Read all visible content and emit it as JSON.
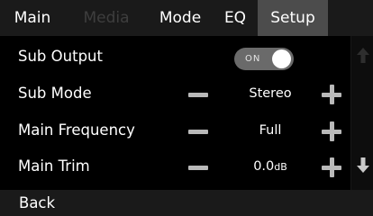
{
  "tabs": [
    {
      "label": "Main",
      "state": "normal"
    },
    {
      "label": "Media",
      "state": "disabled"
    },
    {
      "label": "Mode",
      "state": "normal"
    },
    {
      "label": "EQ",
      "state": "normal"
    },
    {
      "label": "Setup",
      "state": "active"
    }
  ],
  "rows": [
    {
      "label": "Sub Output",
      "toggle": "ON"
    },
    {
      "label": "Sub Mode",
      "value": "Stereo"
    },
    {
      "label": "Main Frequency",
      "value": "Full"
    },
    {
      "label": "Main Trim",
      "value": "0.0",
      "unit": "dB"
    }
  ],
  "scroll": {
    "up_icon": "arrow-up-icon",
    "down_icon": "arrow-down-icon"
  },
  "footer": {
    "back_label": "Back"
  },
  "colors": {
    "background": "#000000",
    "bar": "#1a1a1a",
    "active_tab": "#4c4c4c",
    "disabled_text": "#3e3e3e",
    "control_gray": "#b9b9b9",
    "toggle_track": "#6a6a6a"
  }
}
